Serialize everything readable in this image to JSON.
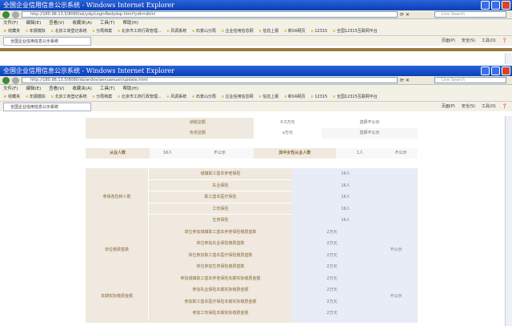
{
  "windows": [
    {
      "title": "全国企业信用信息公示系统 - Windows Internet Explorer",
      "url": "http://180.98.13.5/8080/sb/ydp/LoginRedydsp.html?ydh=dkInl",
      "tab": "全国企业信用信息公示系统"
    },
    {
      "title": "全国企业信用信息公示系统 - Windows Internet Explorer",
      "url": "http://180.98.13.5/8080/sb/andov/annuanuan/update.html",
      "tab": "全国企业信用信息公示系统"
    }
  ],
  "search_placeholder": "Live Search",
  "menu": [
    "文件(F)",
    "编辑(E)",
    "查看(V)",
    "收藏夹(A)",
    "工具(T)",
    "帮助(H)"
  ],
  "favorites": [
    "收藏夹",
    "年报模拟",
    "北京工商登记系统",
    "分局档案",
    "北京市工商行政管理...",
    "风调系统",
    "石景山分局",
    "企业信用信息网",
    "信息上报",
    "新0A网页",
    "12315",
    "全国12315互联网平台"
  ],
  "tools": [
    "页面(P)",
    "安全(S)",
    "工具(O)"
  ],
  "finance": [
    {
      "label": "纳税总额",
      "value": "0.5万元",
      "status": "选择不公示"
    },
    {
      "label": "负债总额",
      "value": "x万元",
      "status": "选择不公示"
    }
  ],
  "employees": {
    "label": "从业人数",
    "value": "16人",
    "status": "不公示",
    "female_label": "其中女性从业人数",
    "female_value": "1人",
    "female_status": "不公示"
  },
  "insurance": {
    "group1": "参保各险种人数",
    "group2": "单位缴费基数",
    "group3": "本期实际缴费金额",
    "status2": "不公示",
    "status3": "不公示",
    "rows": [
      {
        "item": "城镇职工基本养老保险",
        "value": "16人"
      },
      {
        "item": "失业保险",
        "value": "16人"
      },
      {
        "item": "职工基本医疗保险",
        "value": "16人"
      },
      {
        "item": "工伤保险",
        "value": "16人"
      },
      {
        "item": "生育保险",
        "value": "16人"
      },
      {
        "item": "单位参加城镇职工基本养老保险缴费基数",
        "value": "2万元"
      },
      {
        "item": "单位参加失业保险缴费基数",
        "value": "2万元"
      },
      {
        "item": "单位参加职工基本医疗保险缴费基数",
        "value": "2万元"
      },
      {
        "item": "单位参加生育保险缴费基数",
        "value": "2万元"
      },
      {
        "item": "参加城镇职工基本养老保险本期实际缴费金额",
        "value": "2万元"
      },
      {
        "item": "参加失业保险本期实际缴费金额",
        "value": "2万元"
      },
      {
        "item": "参加职工基本医疗保险本期实际缴费金额",
        "value": "2万元"
      },
      {
        "item": "参加工伤保险本期实际缴费金额",
        "value": "2万元"
      }
    ]
  }
}
